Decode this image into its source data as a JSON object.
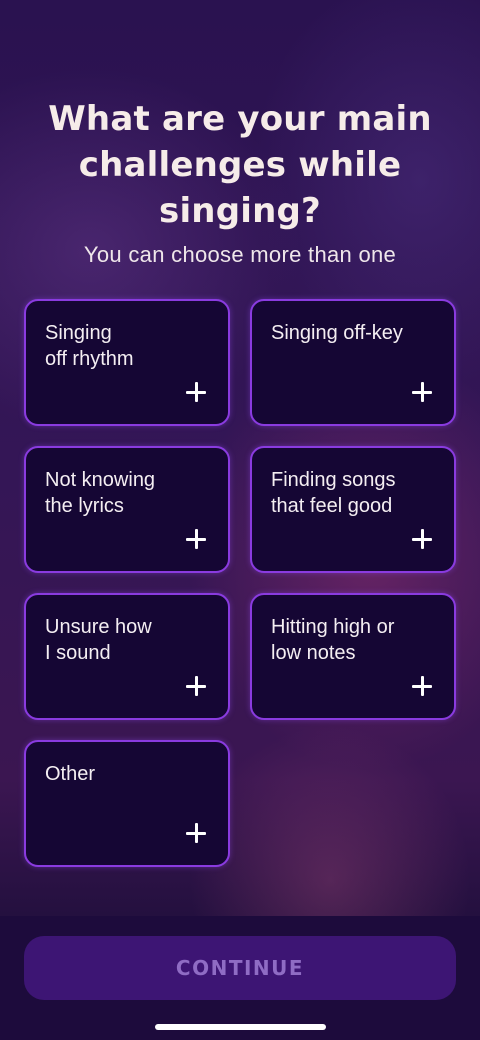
{
  "header": {
    "title": "What are your main challenges while singing?",
    "subtitle": "You can choose more than one"
  },
  "options": [
    {
      "label": "Singing\noff rhythm",
      "selected": false
    },
    {
      "label": "Singing off-key",
      "selected": false
    },
    {
      "label": "Not knowing\nthe lyrics",
      "selected": false
    },
    {
      "label": "Finding songs\nthat feel good",
      "selected": false
    },
    {
      "label": "Unsure how\nI sound",
      "selected": false
    },
    {
      "label": "Hitting high or\nlow notes",
      "selected": false
    },
    {
      "label": "Other",
      "selected": false
    }
  ],
  "option_icon": "plus-icon",
  "footer": {
    "continue_label": "CONTINUE",
    "continue_enabled": false
  },
  "colors": {
    "card_border": "#8a3be0",
    "card_fill": "#150634",
    "button_fill": "#3d1574",
    "button_text_disabled": "#8f6cc4"
  }
}
